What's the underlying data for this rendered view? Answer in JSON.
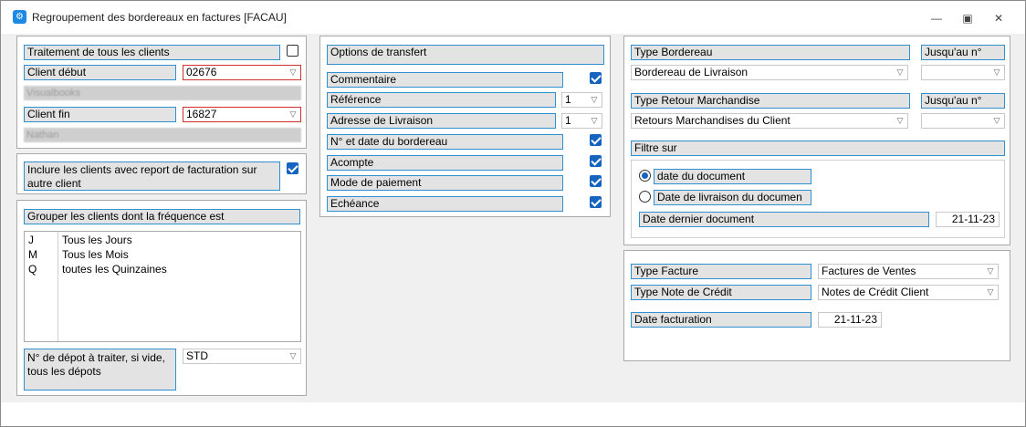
{
  "window": {
    "title": "Regroupement des bordereaux en factures [FACAU]",
    "icon": "app-icon",
    "controls": [
      "minimize-icon",
      "restore-icon",
      "close-icon"
    ]
  },
  "clients": {
    "treat_all_label": "Traitement de tous les clients",
    "treat_all_checked": false,
    "start_label": "Client début",
    "start_value": "02676",
    "start_name": "Visualbooks",
    "end_label": "Client fin",
    "end_value": "16827",
    "end_name": "Nathan"
  },
  "report": {
    "label": "Inclure les clients avec report de facturation sur autre client",
    "checked": true
  },
  "grouping": {
    "label": "Grouper les clients dont la fréquence est",
    "items": [
      {
        "code": "J",
        "label": "Tous les Jours"
      },
      {
        "code": "M",
        "label": "Tous les Mois"
      },
      {
        "code": "Q",
        "label": "toutes les Quinzaines"
      }
    ],
    "depot_label": "N° de dépot à traiter, si vide, tous les dépots",
    "depot_value": "STD"
  },
  "transfer": {
    "title": "Options de transfert",
    "comment_label": "Commentaire",
    "comment_checked": true,
    "reference_label": "Référence",
    "reference_value": "1",
    "address_label": "Adresse de Livraison",
    "address_value": "1",
    "slip_label": "N° et date du bordereau",
    "slip_checked": true,
    "deposit_label": "Acompte",
    "deposit_checked": true,
    "payment_label": "Mode de paiement",
    "payment_checked": true,
    "due_label": "Echéance",
    "due_checked": true
  },
  "slip": {
    "type_label": "Type Bordereau",
    "upto_label": "Jusqu'au n°",
    "type_value": "Bordereau de Livraison",
    "upto_value": "",
    "return_label": "Type Retour Marchandise",
    "return_upto_label": "Jusqu'au n°",
    "return_value": "Retours Marchandises du Client",
    "return_upto_value": ""
  },
  "filter": {
    "label": "Filtre sur",
    "option_doc_date": "date du document",
    "option_delivery_date": "Date de livraison du documen",
    "selected": "date du document",
    "last_doc_label": "Date dernier document",
    "last_doc_value": "21-11-23"
  },
  "invoice": {
    "type_label": "Type Facture",
    "type_value": "Factures de Ventes",
    "credit_label": "Type Note de Crédit",
    "credit_value": "Notes de Crédit Client",
    "date_label": "Date facturation",
    "date_value": "21-11-23"
  },
  "colors": {
    "accent": "#2f8fd0",
    "checkbox": "#1565c0",
    "invalid_border": "#d32f2f",
    "label_bg": "#e3e3e3"
  }
}
